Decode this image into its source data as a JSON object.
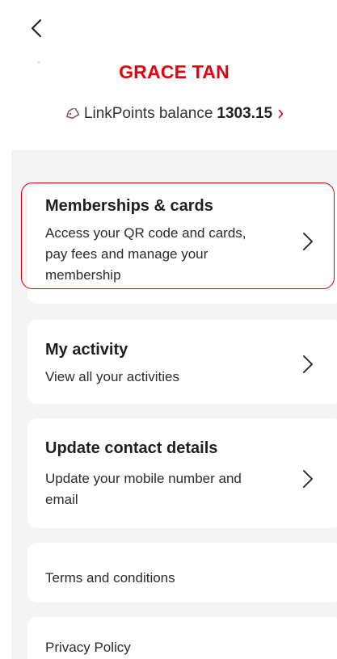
{
  "header": {
    "back_icon": "chevron-left-icon",
    "profile_name": "GRACE TAN",
    "points_label": "LinkPoints balance",
    "points_value": "1303.15",
    "points_icon": "tag-icon"
  },
  "menu": {
    "memberships": {
      "title": "Memberships & cards",
      "desc": "Access your QR code and cards, pay fees and manage your membership"
    },
    "activity": {
      "title": "My activity",
      "desc": "View all your activities"
    },
    "contact": {
      "title": "Update contact details",
      "desc": "Update your mobile number and email"
    },
    "terms": {
      "label": "Terms and conditions"
    },
    "privacy": {
      "label": "Privacy Policy"
    }
  },
  "colors": {
    "accent": "#e8000c",
    "background": "#f4f4f4",
    "card": "#ffffff",
    "highlight": "#d60000"
  }
}
